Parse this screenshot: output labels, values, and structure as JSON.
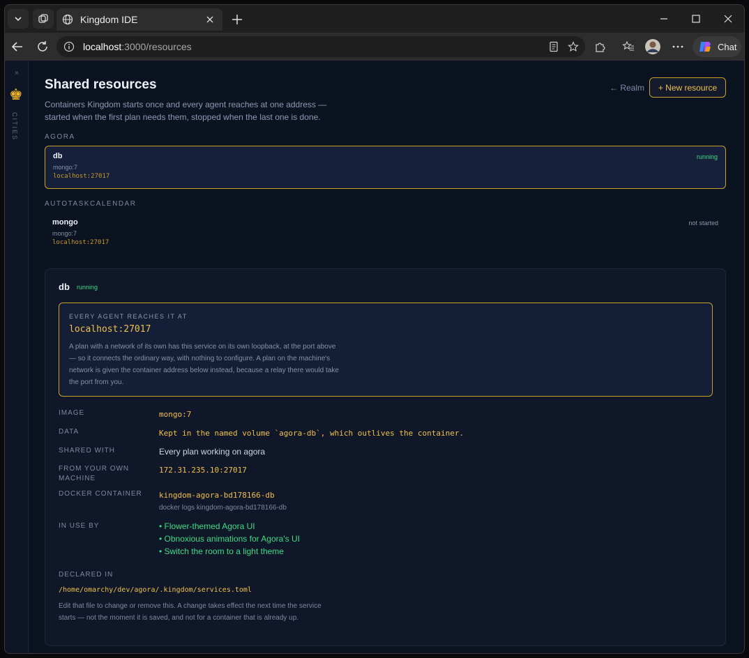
{
  "browser": {
    "tab_title": "Kingdom IDE",
    "url_host": "localhost",
    "url_path": ":3000/resources",
    "chat_label": "Chat"
  },
  "sidebar": {
    "rail_label": "CITIES"
  },
  "header": {
    "title": "Shared resources",
    "subtitle": "Containers Kingdom starts once and every agent reaches at one address — started when the first plan needs them, stopped when the last one is done.",
    "back_link": "← Realm",
    "new_button": "+ New resource"
  },
  "groups": [
    {
      "label": "AGORA",
      "resource": {
        "name": "db",
        "image": "mongo:7",
        "address": "localhost:27017",
        "status": "running"
      }
    },
    {
      "label": "AUTOTASKCALENDAR",
      "resource": {
        "name": "mongo",
        "image": "mongo:7",
        "address": "localhost:27017",
        "status": "not started"
      }
    }
  ],
  "detail": {
    "name": "db",
    "status": "running",
    "reach_label": "EVERY AGENT REACHES IT AT",
    "reach_address": "localhost:27017",
    "reach_text": "A plan with a network of its own has this service on its own loopback, at the port above — so it connects the ordinary way, with nothing to configure. A plan on the machine's network is given the container address below instead, because a relay there would take the port from you.",
    "image_label": "IMAGE",
    "image_value": "mongo:7",
    "data_label": "DATA",
    "data_value": "Kept in the named volume `agora-db`, which outlives the container.",
    "shared_label": "SHARED WITH",
    "shared_value": "Every plan working on agora",
    "from_machine_label": "FROM YOUR OWN MACHINE",
    "from_machine_value": "172.31.235.10:27017",
    "container_label": "DOCKER CONTAINER",
    "container_value": "kingdom-agora-bd178166-db",
    "container_logs": "docker logs kingdom-agora-bd178166-db",
    "in_use_label": "IN USE BY",
    "in_use": [
      "Flower-themed Agora UI",
      "Obnoxious animations for Agora's UI",
      "Switch the room to a light theme"
    ],
    "declared_label": "DECLARED IN",
    "declared_path": "/home/omarchy/dev/agora/.kingdom/services.toml",
    "declared_note": "Edit that file to change or remove this. A change takes effect the next time the service starts — not the moment it is saved, and not for a container that is already up."
  }
}
